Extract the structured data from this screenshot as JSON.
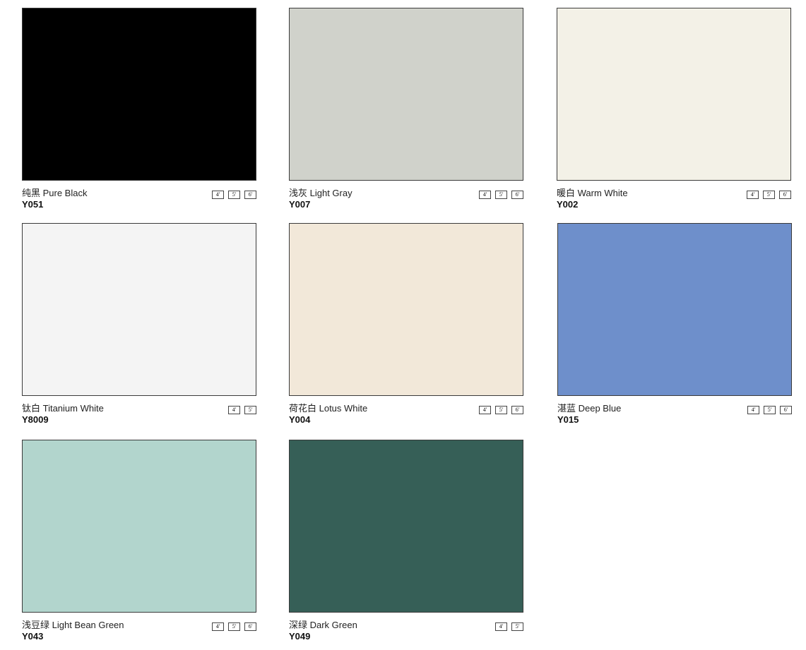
{
  "swatches": [
    {
      "name": "纯黑 Pure Black",
      "code": "Y051",
      "color": "#000000",
      "sizes": [
        "4'",
        "5'",
        "6'"
      ]
    },
    {
      "name": "浅灰 Light Gray",
      "code": "Y007",
      "color": "#d0d2cb",
      "sizes": [
        "4'",
        "5'",
        "6'"
      ]
    },
    {
      "name": "暖白 Warm White",
      "code": "Y002",
      "color": "#f3f1e7",
      "sizes": [
        "4'",
        "5'",
        "6'"
      ]
    },
    {
      "name": "钛白 Titanium White",
      "code": "Y8009",
      "color": "#f4f4f4",
      "sizes": [
        "4'",
        "5'"
      ]
    },
    {
      "name": "荷花白 Lotus White",
      "code": "Y004",
      "color": "#f2e8d9",
      "sizes": [
        "4'",
        "5'",
        "6'"
      ]
    },
    {
      "name": "湛蓝 Deep Blue",
      "code": "Y015",
      "color": "#6e8fcb",
      "sizes": [
        "4'",
        "5'",
        "6'"
      ]
    },
    {
      "name": "浅豆绿 Light Bean Green",
      "code": "Y043",
      "color": "#b2d5cd",
      "sizes": [
        "4'",
        "5'",
        "6'"
      ]
    },
    {
      "name": "深绿 Dark Green",
      "code": "Y049",
      "color": "#365f57",
      "sizes": [
        "4'",
        "5'"
      ]
    }
  ]
}
